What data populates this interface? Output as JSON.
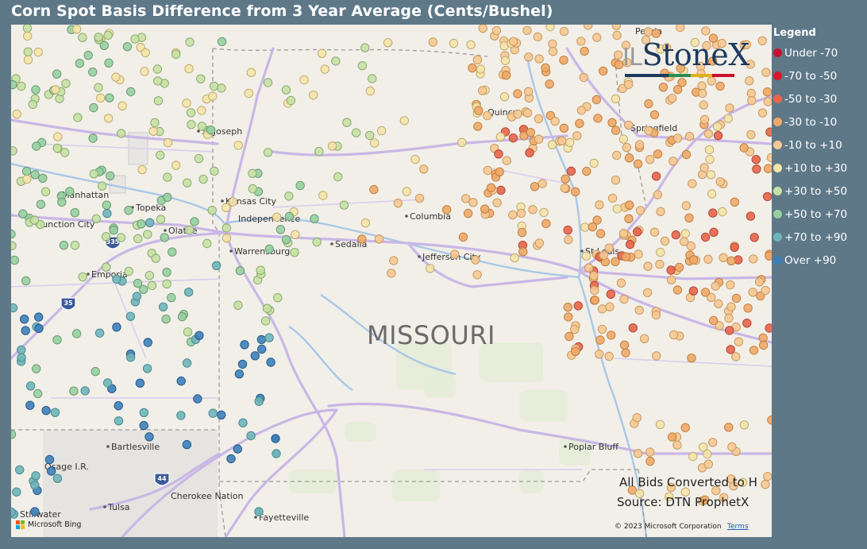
{
  "title": "Corn Spot Basis Difference from 3 Year Average (Cents/Bushel)",
  "legend": {
    "title": "Legend",
    "items": [
      {
        "label": "Under -70",
        "color": "#c8102e"
      },
      {
        "label": "-70 to -50",
        "color": "#d7182a"
      },
      {
        "label": "-50 to -30",
        "color": "#e8644a"
      },
      {
        "label": "-30 to -10",
        "color": "#f0a868"
      },
      {
        "label": "-10 to +10",
        "color": "#f6c892"
      },
      {
        "label": "+10 to +30",
        "color": "#f5e3a8"
      },
      {
        "label": "+30 to +50",
        "color": "#c6e1a4"
      },
      {
        "label": "+50 to +70",
        "color": "#97cfa0"
      },
      {
        "label": "+70 to +90",
        "color": "#6fb5b8"
      },
      {
        "label": "Over +90",
        "color": "#3d7fb9"
      }
    ]
  },
  "map": {
    "state_label": "MISSOURI",
    "cities": [
      "Peoria",
      "St Joseph",
      "Manhattan",
      "Topeka",
      "Kansas City",
      "Independence",
      "Junction City",
      "Olathe",
      "Columbia",
      "Quincy",
      "Springfield",
      "Emporia",
      "Warrensburg",
      "Sedalia",
      "Jefferson City",
      "St Louis",
      "Bartlesville",
      "Osage I.R.",
      "Poplar Bluff",
      "Cherokee Nation",
      "Stillwater",
      "Tulsa",
      "Fayetteville"
    ],
    "highways": [
      "335",
      "35",
      "44"
    ],
    "note_line1": "All Bids Converted to H",
    "note_line2": "Source: DTN ProphetX",
    "copyright": "© 2023 Microsoft Corporation",
    "terms": "Terms",
    "bing": "Microsoft Bing",
    "brand": "StoneX",
    "brand_partial": "IL"
  }
}
